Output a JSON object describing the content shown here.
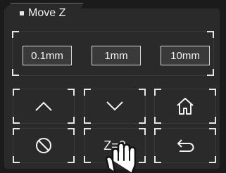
{
  "header": {
    "title": "Move Z"
  },
  "steps": [
    {
      "label": "0.1mm"
    },
    {
      "label": "1mm"
    },
    {
      "label": "10mm"
    }
  ],
  "buttons": [
    {
      "name": "up",
      "icon": "chevron-up-icon"
    },
    {
      "name": "down",
      "icon": "chevron-down-icon"
    },
    {
      "name": "home",
      "icon": "home-icon"
    },
    {
      "name": "stop",
      "icon": "prohibit-icon"
    },
    {
      "name": "z-zero",
      "label": "Z=0",
      "icon": "pointer-hand-icon"
    },
    {
      "name": "back",
      "icon": "return-arrow-icon"
    }
  ],
  "colors": {
    "background": "#1b1b1b",
    "panel": "#2a2a2a",
    "accent": "#f2f2f2"
  }
}
